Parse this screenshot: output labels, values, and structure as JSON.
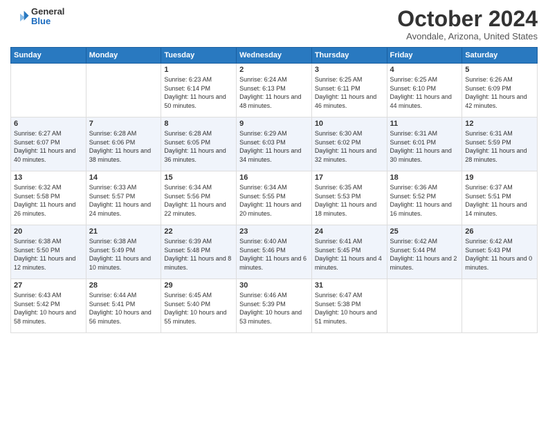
{
  "logo": {
    "general": "General",
    "blue": "Blue"
  },
  "header": {
    "month": "October 2024",
    "location": "Avondale, Arizona, United States"
  },
  "weekdays": [
    "Sunday",
    "Monday",
    "Tuesday",
    "Wednesday",
    "Thursday",
    "Friday",
    "Saturday"
  ],
  "weeks": [
    [
      {
        "day": "",
        "sunrise": "",
        "sunset": "",
        "daylight": ""
      },
      {
        "day": "",
        "sunrise": "",
        "sunset": "",
        "daylight": ""
      },
      {
        "day": "1",
        "sunrise": "Sunrise: 6:23 AM",
        "sunset": "Sunset: 6:14 PM",
        "daylight": "Daylight: 11 hours and 50 minutes."
      },
      {
        "day": "2",
        "sunrise": "Sunrise: 6:24 AM",
        "sunset": "Sunset: 6:13 PM",
        "daylight": "Daylight: 11 hours and 48 minutes."
      },
      {
        "day": "3",
        "sunrise": "Sunrise: 6:25 AM",
        "sunset": "Sunset: 6:11 PM",
        "daylight": "Daylight: 11 hours and 46 minutes."
      },
      {
        "day": "4",
        "sunrise": "Sunrise: 6:25 AM",
        "sunset": "Sunset: 6:10 PM",
        "daylight": "Daylight: 11 hours and 44 minutes."
      },
      {
        "day": "5",
        "sunrise": "Sunrise: 6:26 AM",
        "sunset": "Sunset: 6:09 PM",
        "daylight": "Daylight: 11 hours and 42 minutes."
      }
    ],
    [
      {
        "day": "6",
        "sunrise": "Sunrise: 6:27 AM",
        "sunset": "Sunset: 6:07 PM",
        "daylight": "Daylight: 11 hours and 40 minutes."
      },
      {
        "day": "7",
        "sunrise": "Sunrise: 6:28 AM",
        "sunset": "Sunset: 6:06 PM",
        "daylight": "Daylight: 11 hours and 38 minutes."
      },
      {
        "day": "8",
        "sunrise": "Sunrise: 6:28 AM",
        "sunset": "Sunset: 6:05 PM",
        "daylight": "Daylight: 11 hours and 36 minutes."
      },
      {
        "day": "9",
        "sunrise": "Sunrise: 6:29 AM",
        "sunset": "Sunset: 6:03 PM",
        "daylight": "Daylight: 11 hours and 34 minutes."
      },
      {
        "day": "10",
        "sunrise": "Sunrise: 6:30 AM",
        "sunset": "Sunset: 6:02 PM",
        "daylight": "Daylight: 11 hours and 32 minutes."
      },
      {
        "day": "11",
        "sunrise": "Sunrise: 6:31 AM",
        "sunset": "Sunset: 6:01 PM",
        "daylight": "Daylight: 11 hours and 30 minutes."
      },
      {
        "day": "12",
        "sunrise": "Sunrise: 6:31 AM",
        "sunset": "Sunset: 5:59 PM",
        "daylight": "Daylight: 11 hours and 28 minutes."
      }
    ],
    [
      {
        "day": "13",
        "sunrise": "Sunrise: 6:32 AM",
        "sunset": "Sunset: 5:58 PM",
        "daylight": "Daylight: 11 hours and 26 minutes."
      },
      {
        "day": "14",
        "sunrise": "Sunrise: 6:33 AM",
        "sunset": "Sunset: 5:57 PM",
        "daylight": "Daylight: 11 hours and 24 minutes."
      },
      {
        "day": "15",
        "sunrise": "Sunrise: 6:34 AM",
        "sunset": "Sunset: 5:56 PM",
        "daylight": "Daylight: 11 hours and 22 minutes."
      },
      {
        "day": "16",
        "sunrise": "Sunrise: 6:34 AM",
        "sunset": "Sunset: 5:55 PM",
        "daylight": "Daylight: 11 hours and 20 minutes."
      },
      {
        "day": "17",
        "sunrise": "Sunrise: 6:35 AM",
        "sunset": "Sunset: 5:53 PM",
        "daylight": "Daylight: 11 hours and 18 minutes."
      },
      {
        "day": "18",
        "sunrise": "Sunrise: 6:36 AM",
        "sunset": "Sunset: 5:52 PM",
        "daylight": "Daylight: 11 hours and 16 minutes."
      },
      {
        "day": "19",
        "sunrise": "Sunrise: 6:37 AM",
        "sunset": "Sunset: 5:51 PM",
        "daylight": "Daylight: 11 hours and 14 minutes."
      }
    ],
    [
      {
        "day": "20",
        "sunrise": "Sunrise: 6:38 AM",
        "sunset": "Sunset: 5:50 PM",
        "daylight": "Daylight: 11 hours and 12 minutes."
      },
      {
        "day": "21",
        "sunrise": "Sunrise: 6:38 AM",
        "sunset": "Sunset: 5:49 PM",
        "daylight": "Daylight: 11 hours and 10 minutes."
      },
      {
        "day": "22",
        "sunrise": "Sunrise: 6:39 AM",
        "sunset": "Sunset: 5:48 PM",
        "daylight": "Daylight: 11 hours and 8 minutes."
      },
      {
        "day": "23",
        "sunrise": "Sunrise: 6:40 AM",
        "sunset": "Sunset: 5:46 PM",
        "daylight": "Daylight: 11 hours and 6 minutes."
      },
      {
        "day": "24",
        "sunrise": "Sunrise: 6:41 AM",
        "sunset": "Sunset: 5:45 PM",
        "daylight": "Daylight: 11 hours and 4 minutes."
      },
      {
        "day": "25",
        "sunrise": "Sunrise: 6:42 AM",
        "sunset": "Sunset: 5:44 PM",
        "daylight": "Daylight: 11 hours and 2 minutes."
      },
      {
        "day": "26",
        "sunrise": "Sunrise: 6:42 AM",
        "sunset": "Sunset: 5:43 PM",
        "daylight": "Daylight: 11 hours and 0 minutes."
      }
    ],
    [
      {
        "day": "27",
        "sunrise": "Sunrise: 6:43 AM",
        "sunset": "Sunset: 5:42 PM",
        "daylight": "Daylight: 10 hours and 58 minutes."
      },
      {
        "day": "28",
        "sunrise": "Sunrise: 6:44 AM",
        "sunset": "Sunset: 5:41 PM",
        "daylight": "Daylight: 10 hours and 56 minutes."
      },
      {
        "day": "29",
        "sunrise": "Sunrise: 6:45 AM",
        "sunset": "Sunset: 5:40 PM",
        "daylight": "Daylight: 10 hours and 55 minutes."
      },
      {
        "day": "30",
        "sunrise": "Sunrise: 6:46 AM",
        "sunset": "Sunset: 5:39 PM",
        "daylight": "Daylight: 10 hours and 53 minutes."
      },
      {
        "day": "31",
        "sunrise": "Sunrise: 6:47 AM",
        "sunset": "Sunset: 5:38 PM",
        "daylight": "Daylight: 10 hours and 51 minutes."
      },
      {
        "day": "",
        "sunrise": "",
        "sunset": "",
        "daylight": ""
      },
      {
        "day": "",
        "sunrise": "",
        "sunset": "",
        "daylight": ""
      }
    ]
  ]
}
